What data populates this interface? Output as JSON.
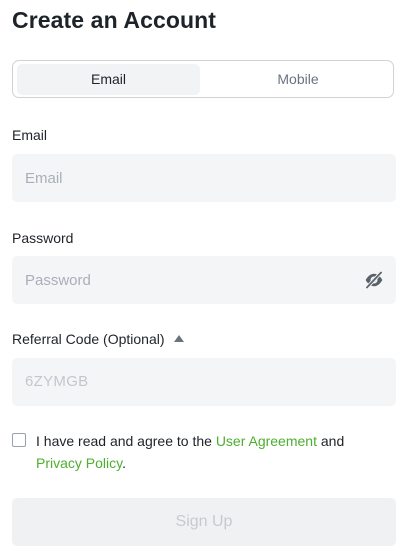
{
  "page": {
    "title": "Create an Account"
  },
  "tabs": {
    "email": "Email",
    "mobile": "Mobile",
    "selected": "Email"
  },
  "form": {
    "email": {
      "label": "Email",
      "placeholder": "Email",
      "value": ""
    },
    "password": {
      "label": "Password",
      "placeholder": "Password",
      "value": "",
      "toggle_icon": "eye-slash-icon"
    },
    "referral": {
      "label": "Referral Code (Optional)",
      "value": "6ZYMGB",
      "toggle_icon": "caret-up-icon"
    }
  },
  "agreement": {
    "checked": false,
    "text_before": "I have read and agree to the ",
    "user_agreement": "User Agreement",
    "text_middle": " and ",
    "privacy_policy": "Privacy Policy",
    "text_after": "."
  },
  "actions": {
    "signup_label": "Sign Up"
  },
  "colors": {
    "accent_link": "#4caf2e",
    "field_bg": "#f4f5f7",
    "disabled_text": "#c6cad0"
  }
}
